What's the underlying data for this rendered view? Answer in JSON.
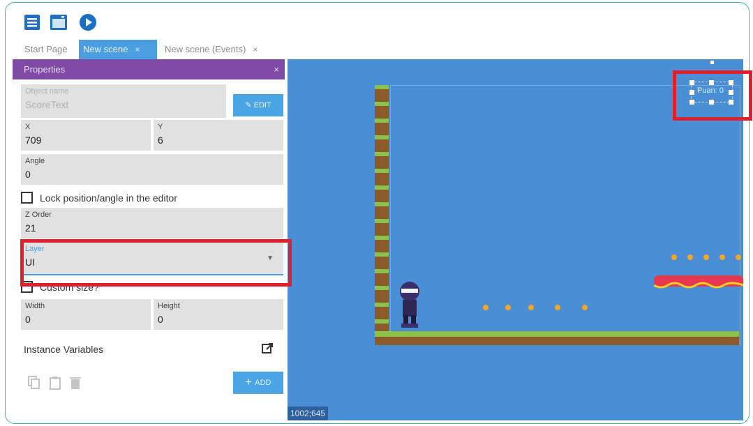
{
  "toolbar": {
    "icons": [
      "project-manager-icon",
      "scene-editor-icon",
      "preview-play-icon"
    ]
  },
  "tabs": [
    {
      "label": "Start Page",
      "active": false
    },
    {
      "label": "New scene",
      "active": true,
      "close": "×"
    },
    {
      "label": "New scene (Events)",
      "active": false,
      "close": "×"
    }
  ],
  "properties": {
    "title": "Properties",
    "close": "×",
    "object_name": {
      "label": "Object name",
      "value": "ScoreText"
    },
    "edit_label": "EDIT",
    "x": {
      "label": "X",
      "value": "709"
    },
    "y": {
      "label": "Y",
      "value": "6"
    },
    "angle": {
      "label": "Angle",
      "value": "0"
    },
    "lock_label": "Lock position/angle in the editor",
    "zorder": {
      "label": "Z Order",
      "value": "21"
    },
    "layer": {
      "label": "Layer",
      "value": "UI"
    },
    "custom_size_label": "Custom size?",
    "width": {
      "label": "Width",
      "value": "0"
    },
    "height": {
      "label": "Height",
      "value": "0"
    },
    "instance_vars_label": "Instance Variables",
    "add_label": "ADD"
  },
  "scene": {
    "score_text": "Puan: 0",
    "coords": "1002;645"
  },
  "colors": {
    "accent": "#4b9fe0",
    "panel_header": "#7f4aa6",
    "highlight": "#e0202a",
    "scene_bg": "#4a8fd6"
  }
}
